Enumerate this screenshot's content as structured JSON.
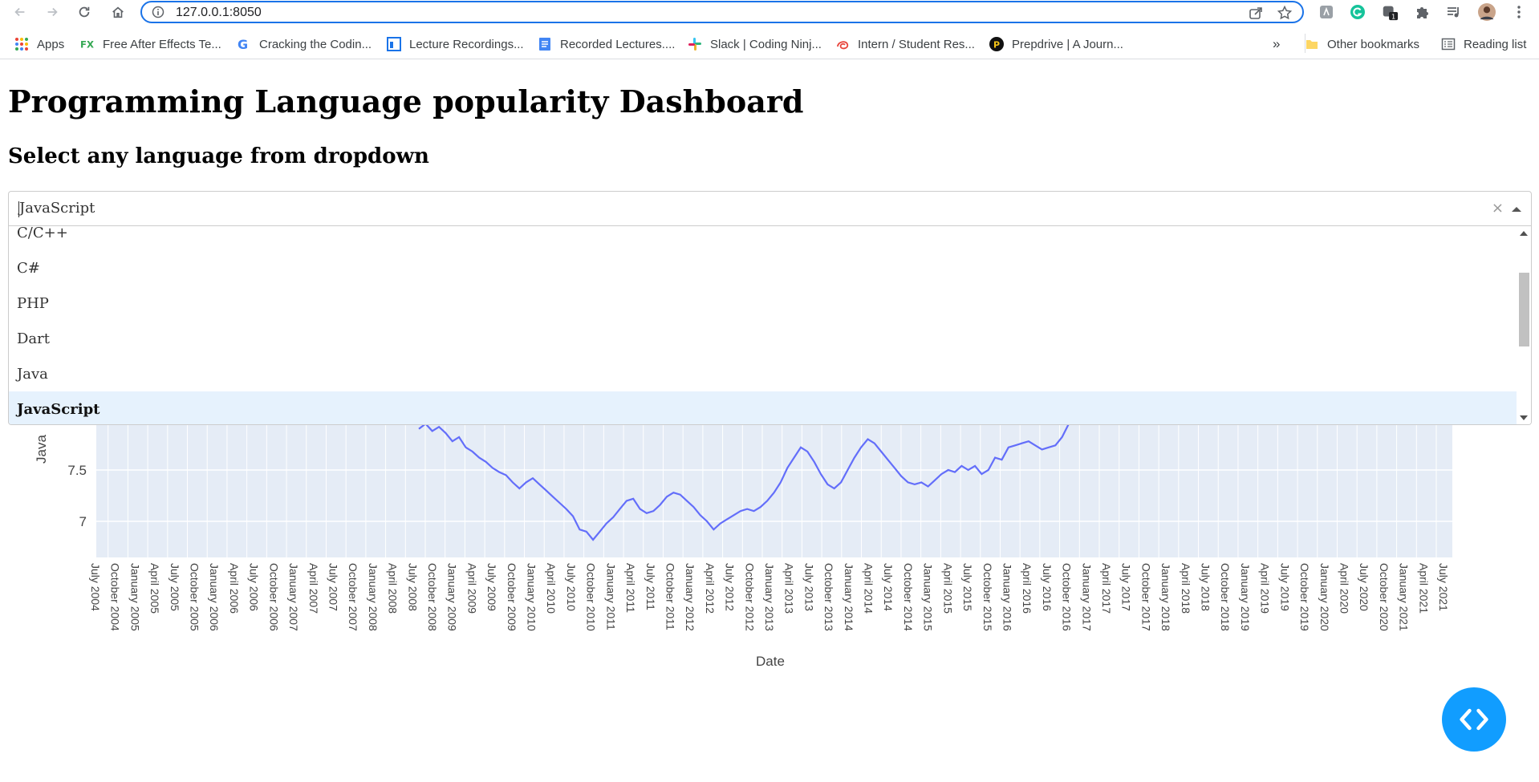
{
  "browser": {
    "url": "127.0.0.1:8050",
    "bookmarks": [
      {
        "label": "Apps",
        "icon": "apps-grid-icon",
        "color": "#ea4335"
      },
      {
        "label": "Free After Effects Te...",
        "icon": "fx-icon",
        "color": "#34a853"
      },
      {
        "label": "Cracking the Codin...",
        "icon": "google-icon",
        "color": "#4285f4"
      },
      {
        "label": "Lecture Recordings...",
        "icon": "board-icon",
        "color": "#1a73e8"
      },
      {
        "label": "Recorded Lectures....",
        "icon": "docs-icon",
        "color": "#4285f4"
      },
      {
        "label": "Slack | Coding Ninj...",
        "icon": "slack-icon",
        "color": "#e01e5a"
      },
      {
        "label": "Intern / Student Res...",
        "icon": "swirl-icon",
        "color": "#e8453c"
      },
      {
        "label": "Prepdrive | A Journ...",
        "icon": "prepdrive-icon",
        "color": "#111111"
      }
    ],
    "overflow": "»",
    "other_bookmarks": "Other bookmarks",
    "reading_list": "Reading list",
    "extension_badge": "1"
  },
  "page": {
    "title": "Programming Language popularity Dashboard",
    "subtitle": "Select any language from dropdown"
  },
  "dropdown": {
    "selected": "JavaScript",
    "clear": "×",
    "options": [
      "C/C++",
      "C#",
      "PHP",
      "Dart",
      "Java",
      "JavaScript"
    ]
  },
  "chart_data": {
    "type": "line",
    "xlabel": "Date",
    "ylabel": "Java",
    "yticks": [
      7,
      7.5
    ],
    "color": "#636efa",
    "plot_bg": "#e5ecf6",
    "x_ticks": [
      "July 2004",
      "October 2004",
      "January 2005",
      "April 2005",
      "July 2005",
      "October 2005",
      "January 2006",
      "April 2006",
      "July 2006",
      "October 2006",
      "January 2007",
      "April 2007",
      "July 2007",
      "October 2007",
      "January 2008",
      "April 2008",
      "July 2008",
      "October 2008",
      "January 2009",
      "April 2009",
      "July 2009",
      "October 2009",
      "January 2010",
      "April 2010",
      "July 2010",
      "October 2010",
      "January 2011",
      "April 2011",
      "July 2011",
      "October 2011",
      "January 2012",
      "April 2012",
      "July 2012",
      "October 2012",
      "January 2013",
      "April 2013",
      "July 2013",
      "October 2013",
      "January 2014",
      "April 2014",
      "July 2014",
      "October 2014",
      "January 2015",
      "April 2015",
      "July 2015",
      "October 2015",
      "January 2016",
      "April 2016",
      "July 2016",
      "October 2016",
      "January 2017",
      "April 2017",
      "July 2017",
      "October 2017",
      "January 2018",
      "April 2018",
      "July 2018",
      "October 2018",
      "January 2019",
      "April 2019",
      "July 2019",
      "October 2019",
      "January 2020",
      "April 2020",
      "July 2020",
      "October 2020",
      "January 2021",
      "April 2021",
      "July 2021"
    ],
    "visible_values": [
      7.9,
      7.95,
      7.88,
      7.92,
      7.86,
      7.78,
      7.82,
      7.72,
      7.68,
      7.62,
      7.58,
      7.52,
      7.48,
      7.45,
      7.38,
      7.32,
      7.38,
      7.42,
      7.36,
      7.3,
      7.24,
      7.18,
      7.12,
      7.05,
      6.92,
      6.9,
      6.82,
      6.9,
      6.98,
      7.04,
      7.12,
      7.2,
      7.22,
      7.12,
      7.08,
      7.1,
      7.16,
      7.24,
      7.28,
      7.26,
      7.2,
      7.14,
      7.06,
      7.0,
      6.92,
      6.98,
      7.02,
      7.06,
      7.1,
      7.12,
      7.1,
      7.14,
      7.2,
      7.28,
      7.38,
      7.52,
      7.62,
      7.72,
      7.68,
      7.58,
      7.46,
      7.36,
      7.32,
      7.38,
      7.5,
      7.62,
      7.72,
      7.8,
      7.76,
      7.68,
      7.6,
      7.52,
      7.44,
      7.38,
      7.36,
      7.38,
      7.34,
      7.4,
      7.46,
      7.5,
      7.48,
      7.54,
      7.5,
      7.54,
      7.46,
      7.5,
      7.62,
      7.6,
      7.72,
      7.74,
      7.76,
      7.78,
      7.74,
      7.7,
      7.72,
      7.74,
      7.82,
      7.95
    ]
  }
}
